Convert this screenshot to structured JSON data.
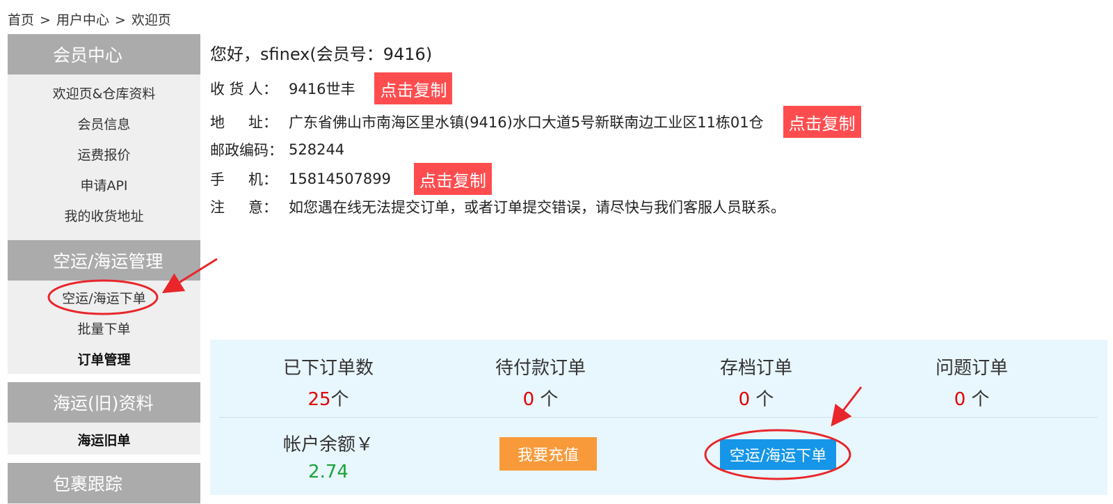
{
  "breadcrumb": {
    "home": "首页",
    "user_center": "用户中心",
    "current": "欢迎页",
    "separator": ">"
  },
  "sidebar": {
    "sections": [
      {
        "title": "会员中心",
        "items": [
          "欢迎页&仓库资料",
          "会员信息",
          "运费报价",
          "申请API",
          "我的收货地址"
        ]
      },
      {
        "title": "空运/海运管理",
        "items": [
          "空运/海运下单",
          "批量下单",
          "订单管理"
        ]
      },
      {
        "title": "海运(旧)资料",
        "items": [
          "海运旧单"
        ]
      },
      {
        "title": "包裹跟踪",
        "items": []
      }
    ]
  },
  "info": {
    "greeting": "您好，sfinex(会员号：9416)",
    "receiver_label_chars": [
      "收",
      "货",
      "人："
    ],
    "receiver_value": "9416世丰",
    "address_label_chars": [
      "地",
      "址："
    ],
    "address_value": "广东省佛山市南海区里水镇(9416)水口大道5号新联南边工业区11栋01仓",
    "postcode_label": "邮政编码：",
    "postcode_value": "528244",
    "phone_label_chars": [
      "手",
      "机："
    ],
    "phone_value": "15814507899",
    "note_label_chars": [
      "注",
      "意："
    ],
    "note_value": "如您遇在线无法提交订单，或者订单提交错误，请尽快与我们客服人员联系。",
    "copy_label": "点击复制"
  },
  "stats": {
    "placed_label": "已下订单数",
    "placed_count": "25",
    "placed_unit": "个",
    "unpaid_label": "待付款订单",
    "unpaid_count": "0",
    "unpaid_unit": " 个",
    "archived_label": "存档订单",
    "archived_count": "0",
    "archived_unit": " 个",
    "problem_label": "问题订单",
    "problem_count": "0",
    "problem_unit": " 个",
    "balance_label": "帐户余额￥",
    "balance_value": "2.74",
    "recharge_label": "我要充值",
    "order_label": "空运/海运下单"
  },
  "colors": {
    "sidebar_header": "#ababab",
    "sidebar_bg": "#efefef",
    "copy_button": "#ff4d4f",
    "stats_bg": "#e8f6fd",
    "recharge_button": "#f99a3a",
    "order_button": "#1596e8",
    "count_red": "#e10000",
    "balance_green": "#19a33a",
    "annotation_red": "#e8262b"
  }
}
